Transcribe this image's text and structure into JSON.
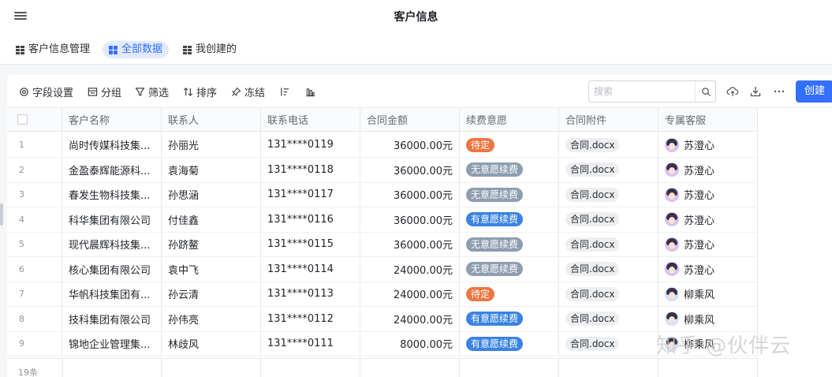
{
  "app": {
    "title": "客户信息"
  },
  "tabs": [
    {
      "label": "客户信息管理",
      "icon": "table-icon",
      "active": false
    },
    {
      "label": "全部数据",
      "icon": "grid-icon",
      "active": true
    },
    {
      "label": "我创建的",
      "icon": "table-icon",
      "active": false
    }
  ],
  "toolbar": {
    "field_settings": "字段设置",
    "group": "分组",
    "filter": "筛选",
    "sort": "排序",
    "freeze": "冻结",
    "search_placeholder": "搜索",
    "create": "创建"
  },
  "table": {
    "columns": [
      "客户名称",
      "联系人",
      "联系电话",
      "合同金额",
      "续费意愿",
      "合同附件",
      "专属客服"
    ],
    "rows": [
      {
        "no": "1",
        "name": "尚时传媒科技集...",
        "contact": "孙丽光",
        "phone": "131****0119",
        "amount": "36000.00元",
        "intent": "待定",
        "intent_color": "orange",
        "file": "合同.docx",
        "agent": "苏澄心",
        "avatar": "a"
      },
      {
        "no": "2",
        "name": "金盈泰辉能源科...",
        "contact": "袁海菊",
        "phone": "131****0118",
        "amount": "36000.00元",
        "intent": "无意愿续费",
        "intent_color": "gray",
        "file": "合同.docx",
        "agent": "苏澄心",
        "avatar": "a"
      },
      {
        "no": "3",
        "name": "春发生物科技集...",
        "contact": "孙思涵",
        "phone": "131****0117",
        "amount": "36000.00元",
        "intent": "无意愿续费",
        "intent_color": "gray",
        "file": "合同.docx",
        "agent": "苏澄心",
        "avatar": "a"
      },
      {
        "no": "4",
        "name": "科华集团有限公司",
        "contact": "付佳鑫",
        "phone": "131****0116",
        "amount": "36000.00元",
        "intent": "有意愿续费",
        "intent_color": "blue",
        "file": "合同.docx",
        "agent": "苏澄心",
        "avatar": "a"
      },
      {
        "no": "5",
        "name": "现代晨辉科技集...",
        "contact": "孙跻鳌",
        "phone": "131****0115",
        "amount": "36000.00元",
        "intent": "无意愿续费",
        "intent_color": "gray",
        "file": "合同.docx",
        "agent": "苏澄心",
        "avatar": "a"
      },
      {
        "no": "6",
        "name": "核心集团有限公司",
        "contact": "袁中飞",
        "phone": "131****0114",
        "amount": "24000.00元",
        "intent": "无意愿续费",
        "intent_color": "gray",
        "file": "合同.docx",
        "agent": "苏澄心",
        "avatar": "a"
      },
      {
        "no": "7",
        "name": "华帆科技集团有...",
        "contact": "孙云清",
        "phone": "131****0113",
        "amount": "24000.00元",
        "intent": "待定",
        "intent_color": "orange",
        "file": "合同.docx",
        "agent": "柳乘风",
        "avatar": "b"
      },
      {
        "no": "8",
        "name": "技科集团有限公司",
        "contact": "孙伟亮",
        "phone": "131****0112",
        "amount": "24000.00元",
        "intent": "有意愿续费",
        "intent_color": "blue",
        "file": "合同.docx",
        "agent": "柳乘风",
        "avatar": "b"
      },
      {
        "no": "9",
        "name": "锦地企业管理集...",
        "contact": "林歧风",
        "phone": "131****0111",
        "amount": "8000.00元",
        "intent": "有意愿续费",
        "intent_color": "blue",
        "file": "合同.docx",
        "agent": "柳乘风",
        "avatar": "b"
      }
    ],
    "total": "19条"
  },
  "colors": {
    "accent": "#3370ff",
    "orange": "#ed7744",
    "gray": "#8e9db0",
    "blue": "#3a83e3"
  },
  "watermark": "知乎 @伙伴云"
}
